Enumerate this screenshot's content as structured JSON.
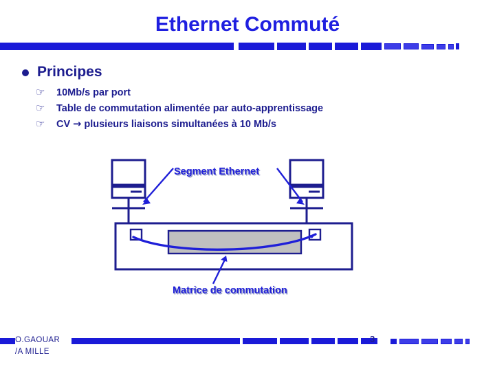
{
  "slide": {
    "title": "Ethernet Commuté",
    "page_number": "3",
    "accent_color": "#1f1fe0",
    "text_color": "#1d1d8f",
    "matrix_fill_color": "#c0c0c0",
    "background_color": "#ffffff"
  },
  "bullets": {
    "level1": {
      "marker": "filled-circle",
      "label": "Principes"
    },
    "level2_marker": "☞",
    "level2": [
      {
        "text": "10Mb/s par port"
      },
      {
        "text": "Table de commutation alimentée par auto-apprentissage"
      },
      {
        "text_before_arrow": "CV ",
        "arrow": "→",
        "text_after_arrow": " plusieurs liaisons simultanées à 10 Mb/s"
      }
    ]
  },
  "diagram": {
    "label_segment": "Segment Ethernet",
    "label_matrix": "Matrice de commutation",
    "nodes": {
      "left_computer": "workstation-left",
      "right_computer": "workstation-right",
      "switch": "switch-chassis",
      "matrix": "switching-matrix",
      "port_left": "switch-port-left",
      "port_right": "switch-port-right",
      "circuit": "virtual-circuit-curve"
    }
  },
  "footer": {
    "author_line1": "O.GAOUAR",
    "author_line2": "/A MILLE"
  }
}
